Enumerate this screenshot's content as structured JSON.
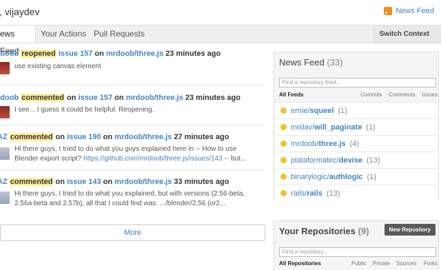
{
  "header": {
    "greeting": "i, vijaydev",
    "news_feed_link": "News Feed"
  },
  "tabs": [
    {
      "label": "ews Feed"
    },
    {
      "label": "Your Actions"
    },
    {
      "label": "Pull Requests"
    }
  ],
  "switch_context": "Switch Context",
  "feed": [
    {
      "actor": "rdoob",
      "action": "reopened",
      "target": "issue 157",
      "on": "on",
      "repo": "mrdoob/three.js",
      "time": "23 minutes ago",
      "body": "use existing canvas element",
      "url": "",
      "body_tail": ""
    },
    {
      "actor": "rdoob",
      "action": "commented",
      "on_word": "on",
      "target": "issue 157",
      "on": "on",
      "repo": "mrdoob/three.js",
      "time": "23 minutes ago",
      "body": "I see... I guess it could be helpful. Reopening.",
      "url": "",
      "body_tail": ""
    },
    {
      "actor": "AZ",
      "action": "commented",
      "on_word": "on",
      "target": "issue 190",
      "on": "on",
      "repo": "mrdoob/three.js",
      "time": "27 minutes ago",
      "body": "Hi there guys, I tried to do what you guys explained here in -- How to use Blender export script? ",
      "url": "https://github.com/mrdoob/three.js/issues/143",
      "body_tail": " -- but..."
    },
    {
      "actor": "AZ",
      "action": "commented",
      "on_word": "on",
      "target": "issue 143",
      "on": "on",
      "repo": "mrdoob/three.js",
      "time": "33 minutes ago",
      "body": "Hi there guys, I tried to do what you explained, but with versions (2.56-beta, 2.56a-beta and 2.57b), all that I could find was: .../blender/2.56 (or2...",
      "url": "",
      "body_tail": ""
    }
  ],
  "more_label": "More",
  "news_panel": {
    "title": "News Feed",
    "count": "(33)",
    "search_placeholder": "Find a repository feed...",
    "filters": {
      "active": "All Feeds",
      "commits": "Commits",
      "comments": "Comments",
      "issues": "Issues"
    },
    "repos": [
      {
        "owner": "ernie/",
        "name": "squeel",
        "count": "(1)"
      },
      {
        "owner": "mislav/",
        "name": "will_paginate",
        "count": "(1)"
      },
      {
        "owner": "mrdoob/",
        "name": "three.js",
        "count": "(4)"
      },
      {
        "owner": "plataformatec/",
        "name": "devise",
        "count": "(13)"
      },
      {
        "owner": "binarylogic/",
        "name": "authlogic",
        "count": "(1)"
      },
      {
        "owner": "rails/",
        "name": "rails",
        "count": "(13)"
      }
    ]
  },
  "repos_panel": {
    "title": "Your Repositories",
    "count": "(9)",
    "new_button": "New Repository",
    "search_placeholder": "Find a repository...",
    "filters": {
      "active": "All Repositories",
      "public": "Public",
      "private": "Private",
      "sources": "Sources",
      "forks": "Forks"
    }
  },
  "colors": {
    "link": "#4183c4",
    "highlight": "#ffef9a",
    "rss": "#f28c1a"
  },
  "icons": [
    "rss-icon",
    "smile-icon",
    "avatar"
  ]
}
